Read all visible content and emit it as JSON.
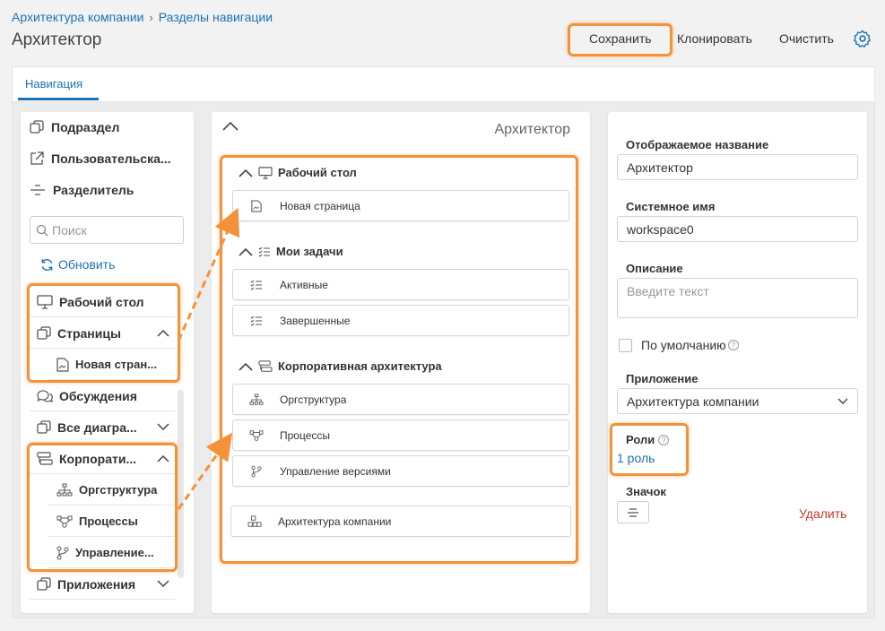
{
  "breadcrumb": {
    "parent": "Архитектура компании",
    "current": "Разделы навигации"
  },
  "page_title": "Архитектор",
  "header_actions": {
    "save": "Сохранить",
    "clone": "Клонировать",
    "clear": "Очистить"
  },
  "tabs": {
    "navigation": "Навигация"
  },
  "left_panel": {
    "add_items": {
      "subsection": "Подраздел",
      "custom": "Пользовательска...",
      "divider": "Разделитель"
    },
    "search_placeholder": "Поиск",
    "refresh": "Обновить",
    "tree": {
      "workspace": "Рабочий стол",
      "pages": "Страницы",
      "new_page": "Новая стран...",
      "discussions": "Обсуждения",
      "all_diagrams": "Все диагра...",
      "corporate": "Корпорати...",
      "org": "Оргструктура",
      "processes": "Процессы",
      "version_mgmt": "Управление...",
      "apps": "Приложения"
    }
  },
  "middle_panel": {
    "title": "Архитектор",
    "groups": {
      "workspace": {
        "label": "Рабочий стол",
        "items": [
          "Новая страница"
        ]
      },
      "tasks": {
        "label": "Мои задачи",
        "items": [
          "Активные",
          "Завершенные"
        ]
      },
      "corporate": {
        "label": "Корпоративная архитектура",
        "items": [
          "Оргструктура",
          "Процессы",
          "Управление версиями"
        ]
      }
    },
    "app_item": "Архитектура компании"
  },
  "right_panel": {
    "display_name_label": "Отображаемое название",
    "display_name_value": "Архитектор",
    "system_name_label": "Системное имя",
    "system_name_value": "workspace0",
    "description_label": "Описание",
    "description_placeholder": "Введите текст",
    "default_label": "По умолчанию",
    "app_label": "Приложение",
    "app_value": "Архитектура компании",
    "roles_label": "Роли",
    "roles_value": "1 роль",
    "icon_label": "Значок",
    "delete": "Удалить"
  },
  "colors": {
    "accent": "#1b73b4",
    "highlight": "#f4923a",
    "danger": "#c0392b"
  }
}
